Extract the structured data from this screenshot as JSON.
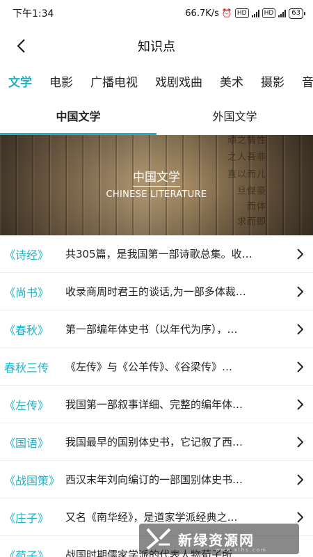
{
  "status": {
    "time": "下午1:34",
    "speed": "66.7K/s",
    "battery": "63"
  },
  "header": {
    "title": "知识点"
  },
  "categories": [
    "文学",
    "电影",
    "广播电视",
    "戏剧戏曲",
    "美术",
    "摄影",
    "音"
  ],
  "sub_tabs": [
    "中国文学",
    "外国文学"
  ],
  "banner": {
    "title": "中国文学",
    "subtitle": "CHINESE LITERATURE"
  },
  "items": [
    {
      "title": "《诗经》",
      "desc": "共305篇，是我国第一部诗歌总集。收…"
    },
    {
      "title": "《尚书》",
      "desc": "收录商周时君王的谈话,为一部多体裁…"
    },
    {
      "title": "《春秋》",
      "desc": "第一部编年体史书（以年代为序），…"
    },
    {
      "title": "春秋三传",
      "desc": "《左传》与《公羊传》、《谷梁传》…"
    },
    {
      "title": "《左传》",
      "desc": "我国第一部叙事详细、完整的编年体…"
    },
    {
      "title": "《国语》",
      "desc": "我国最早的国别体史书，它记叙了西…"
    },
    {
      "title": "《战国策》",
      "desc": "西汉末年刘向编订的一部国别体史书…"
    },
    {
      "title": "《庄子》",
      "desc": "又名《南华经》，是道家学派经典之…"
    },
    {
      "title": "《荀子》",
      "desc": "战国时期儒家学派的代表人物荀子所…"
    }
  ],
  "watermark": {
    "text": "新绿资源网",
    "url": "www.xlhs.com"
  },
  "colors": {
    "accent": "#1fb3c9"
  }
}
